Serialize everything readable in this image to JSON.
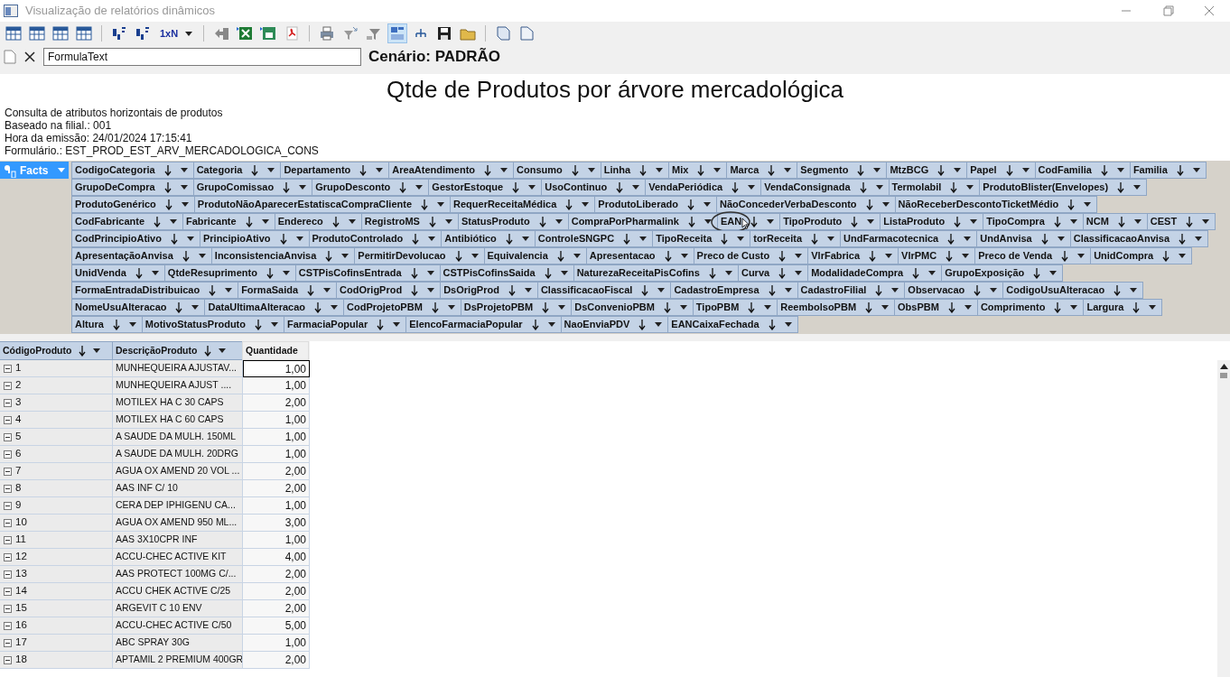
{
  "window": {
    "title": "Visualização de relatórios dinâmicos"
  },
  "toolbar": [
    {
      "kind": "icon",
      "pressed": false
    },
    {
      "kind": "icon",
      "pressed": false
    },
    {
      "kind": "icon",
      "pressed": false
    },
    {
      "kind": "icon",
      "pressed": false
    },
    {
      "kind": "sep"
    },
    {
      "kind": "icon",
      "pressed": false
    },
    {
      "kind": "icon",
      "pressed": false
    },
    {
      "kind": "text",
      "label": "1xN"
    },
    {
      "kind": "sep"
    },
    {
      "kind": "icon",
      "pressed": false
    },
    {
      "kind": "icon",
      "pressed": false
    },
    {
      "kind": "icon",
      "pressed": false
    },
    {
      "kind": "icon",
      "pressed": false
    },
    {
      "kind": "sep"
    },
    {
      "kind": "icon",
      "pressed": false
    },
    {
      "kind": "icon",
      "pressed": false
    },
    {
      "kind": "icon",
      "pressed": false
    },
    {
      "kind": "icon",
      "pressed": true
    },
    {
      "kind": "icon",
      "pressed": false
    },
    {
      "kind": "icon",
      "pressed": false
    },
    {
      "kind": "icon",
      "pressed": false
    },
    {
      "kind": "sep"
    },
    {
      "kind": "icon",
      "pressed": false
    },
    {
      "kind": "icon",
      "pressed": false
    }
  ],
  "formula": {
    "value": "FormulaText"
  },
  "scenario": "Cenário: PADRÃO",
  "report_title": "Qtde de Produtos por árvore mercadológica",
  "info_lines": [
    "Consulta de atributos horizontais de produtos",
    "Baseado na filial.: 001",
    "Hora da emissão: 24/01/2024 17:15:41",
    "Formulário.: EST_PROD_EST_ARV_MERCADOLOGICA_CONS"
  ],
  "facts_button": "Facts",
  "field_rows": [
    [
      "CodigoCategoria",
      "Categoria",
      "Departamento",
      "AreaAtendimento",
      "Consumo",
      "Linha",
      "Mix",
      "Marca",
      "Segmento",
      "MtzBCG",
      "Papel",
      "CodFamilia",
      "Familia"
    ],
    [
      "GrupoDeCompra",
      "GrupoComissao",
      "GrupoDesconto",
      "GestorEstoque",
      "UsoContinuo",
      "VendaPeriódica",
      "VendaConsignada",
      "Termolabil",
      "ProdutoBlister(Envelopes)"
    ],
    [
      "ProdutoGenérico",
      "ProdutoNãoAparecerEstatiscaCompraCliente",
      "RequerReceitaMédica",
      "ProdutoLiberado",
      "NãoConcederVerbaDesconto",
      "NãoReceberDescontoTicketMédio"
    ],
    [
      "CodFabricante",
      "Fabricante",
      "Endereco",
      "RegistroMS",
      "StatusProduto",
      "CompraPorPharmalink",
      "EAN",
      "TipoProduto",
      "ListaProduto",
      "TipoCompra",
      "NCM",
      "CEST"
    ],
    [
      "CodPrincipioAtivo",
      "PrincipioAtivo",
      "ProdutoControlado",
      "Antibiótico",
      "ControleSNGPC",
      "TipoReceita",
      "torReceita",
      "UndFarmacotecnica",
      "UndAnvisa",
      "ClassificacaoAnvisa"
    ],
    [
      "ApresentaçãoAnvisa",
      "InconsistenciaAnvisa",
      "PermitirDevolucao",
      "Equivalencia",
      "Apresentacao",
      "Preco de Custo",
      "VlrFabrica",
      "VlrPMC",
      "Preco de Venda",
      "UnidCompra"
    ],
    [
      "UnidVenda",
      "QtdeResuprimento",
      "CSTPisCofinsEntrada",
      "CSTPisCofinsSaida",
      "NaturezaReceitaPisCofins",
      "Curva",
      "ModalidadeCompra",
      "GrupoExposição"
    ],
    [
      "FormaEntradaDistribuicao",
      "FormaSaida",
      "CodOrigProd",
      "DsOrigProd",
      "ClassificacaoFiscal",
      "CadastroEmpresa",
      "CadastroFilial",
      "Observacao",
      "CodigoUsuAlteracao"
    ],
    [
      "NomeUsuAlteracao",
      "DataUltimaAlteracao",
      "CodProjetoPBM",
      "DsProjetoPBM",
      "DsConvenioPBM",
      "TipoPBM",
      "ReembolsoPBM",
      "ObsPBM",
      "Comprimento",
      "Largura"
    ],
    [
      "Altura",
      "MotivoStatusProduto",
      "FarmaciaPopular",
      "ElencoFarmaciaPopular",
      "NaoEnviaPDV",
      "EANCaixaFechada"
    ]
  ],
  "table": {
    "columns": [
      {
        "label": "CódigoProduto",
        "sortable": true
      },
      {
        "label": "DescriçãoProduto",
        "sortable": true
      },
      {
        "label": "Quantidade",
        "sortable": false
      }
    ],
    "rows": [
      {
        "code": "1",
        "description": "MUNHEQUEIRA  AJUSTAV...",
        "quantity": "1,00",
        "selected": true
      },
      {
        "code": "2",
        "description": "MUNHEQUEIRA  AJUST ....",
        "quantity": "1,00",
        "selected": false
      },
      {
        "code": "3",
        "description": "MOTILEX HA C 30 CAPS",
        "quantity": "2,00",
        "selected": false
      },
      {
        "code": "4",
        "description": "MOTILEX HA C 60 CAPS",
        "quantity": "1,00",
        "selected": false
      },
      {
        "code": "5",
        "description": "A SAUDE DA MULH.  150ML",
        "quantity": "1,00",
        "selected": false
      },
      {
        "code": "6",
        "description": "A SAUDE DA MULH.  20DRG",
        "quantity": "1,00",
        "selected": false
      },
      {
        "code": "7",
        "description": "AGUA OX AMEND 20 VOL ...",
        "quantity": "2,00",
        "selected": false
      },
      {
        "code": "8",
        "description": "AAS INF C/ 10",
        "quantity": "2,00",
        "selected": false
      },
      {
        "code": "9",
        "description": "CERA  DEP IPHIGENU CA...",
        "quantity": "1,00",
        "selected": false
      },
      {
        "code": "10",
        "description": "AGUA  OX AMEND 950 ML...",
        "quantity": "3,00",
        "selected": false
      },
      {
        "code": "11",
        "description": "AAS 3X10CPR INF",
        "quantity": "1,00",
        "selected": false
      },
      {
        "code": "12",
        "description": "ACCU-CHEC ACTIVE KIT",
        "quantity": "4,00",
        "selected": false
      },
      {
        "code": "13",
        "description": "AAS PROTECT 100MG C/...",
        "quantity": "2,00",
        "selected": false
      },
      {
        "code": "14",
        "description": "ACCU CHEK ACTIVE C/25",
        "quantity": "2,00",
        "selected": false
      },
      {
        "code": "15",
        "description": "ARGEVIT C 10 ENV",
        "quantity": "2,00",
        "selected": false
      },
      {
        "code": "16",
        "description": "ACCU-CHEC  ACTIVE C/50",
        "quantity": "5,00",
        "selected": false
      },
      {
        "code": "17",
        "description": "ABC SPRAY 30G",
        "quantity": "1,00",
        "selected": false
      },
      {
        "code": "18",
        "description": "APTAMIL 2 PREMIUM 400GR",
        "quantity": "2,00",
        "selected": false
      }
    ]
  }
}
